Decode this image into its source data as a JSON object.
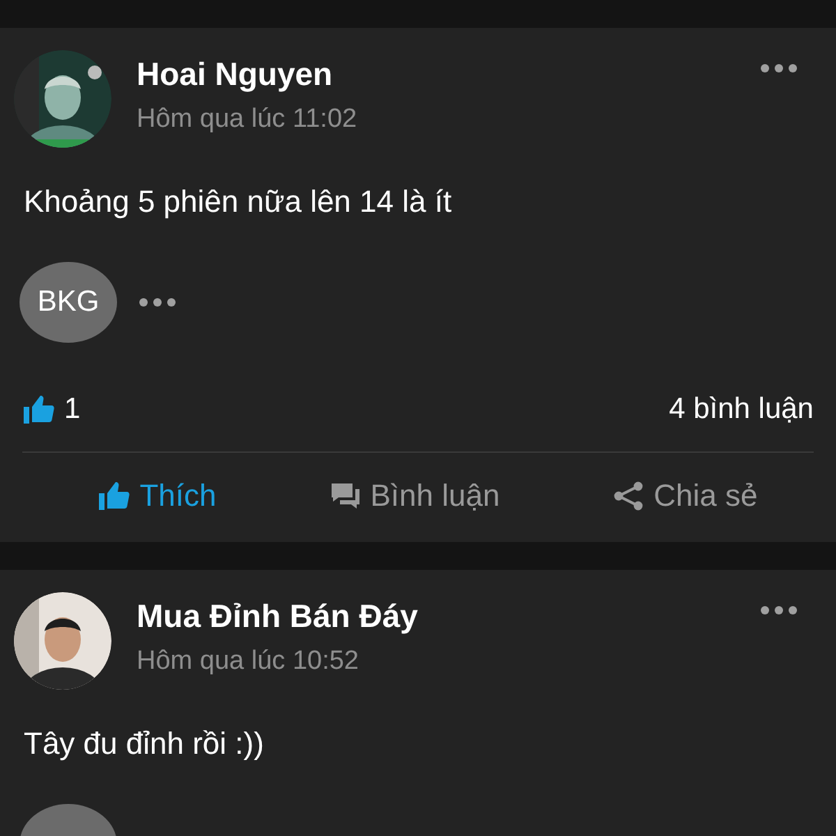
{
  "posts": [
    {
      "author": "Hoai Nguyen",
      "time": "Hôm qua lúc 11:02",
      "text": "Khoảng 5 phiên nữa lên 14 là ít",
      "tag": {
        "kind": "label",
        "label": "BKG"
      },
      "tag_more": true,
      "likes": "1",
      "comments": "4 bình luận",
      "actions": [
        {
          "kind": "like",
          "label": "Thích",
          "selected": true
        },
        {
          "kind": "comment",
          "label": "Bình luận",
          "selected": false
        },
        {
          "kind": "share",
          "label": "Chia sẻ",
          "selected": false
        }
      ]
    },
    {
      "author": "Mua Đỉnh Bán Đáy",
      "time": "Hôm qua lúc 10:52",
      "text": "Tây đu đỉnh rồi :))",
      "tag": {
        "kind": "cut"
      }
    }
  ]
}
